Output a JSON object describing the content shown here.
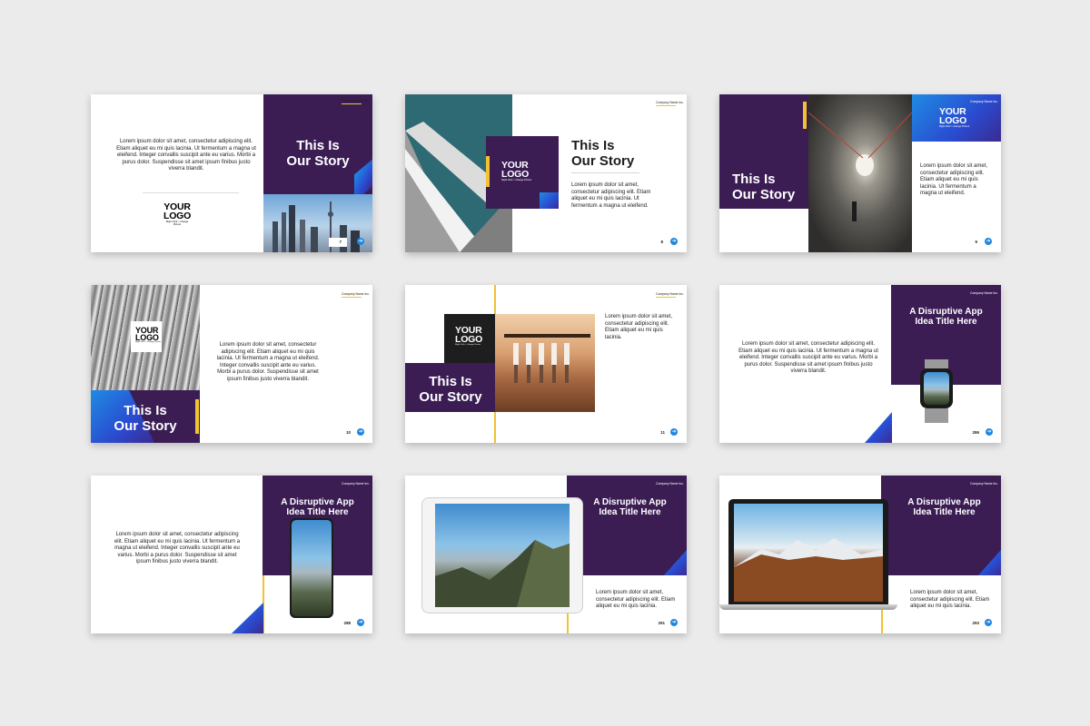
{
  "slides": [
    {
      "body": "Lorem ipsum dolor sit amet, consectetur adipiscing elit. Etiam aliquet eu mi quis lacinia. Ut fermentum a magna ut eleifend. Integer convallis suscipit ante eu varius. Morbi a purus dolor. Suspendisse sit amet ipsum finibus justo viverra blandit.",
      "logo_line1": "YOUR",
      "logo_line2": "LOGO",
      "logo_sub": "Right Click > Change Picture",
      "company": "Company Name Inc.",
      "title_line1": "This Is",
      "title_line2": "Our Story",
      "page": "7"
    },
    {
      "company": "Company Name Inc.",
      "logo_line1": "YOUR",
      "logo_line2": "LOGO",
      "logo_sub": "Right Click > Change Picture",
      "title_line1": "This Is",
      "title_line2": "Our Story",
      "body": "Lorem ipsum dolor sit amet, consectetur adipiscing elit. Etiam aliquet eu mi quis lacinia. Ut fermentum a magna ut eleifend.",
      "page": "8"
    },
    {
      "company": "Company Name Inc.",
      "logo_line1": "YOUR",
      "logo_line2": "LOGO",
      "logo_sub": "Right Click > Change Picture",
      "title_line1": "This Is",
      "title_line2": "Our Story",
      "body": "Lorem ipsum dolor sit amet, consectetur adipiscing elit. Etiam aliquet eu mi quis lacinia. Ut fermentum a magna ut eleifend.",
      "page": "9"
    },
    {
      "logo_line1": "YOUR",
      "logo_line2": "LOGO",
      "logo_sub": "Right Click > Change Picture",
      "title_line1": "This Is",
      "title_line2": "Our Story",
      "company": "Company Name Inc.",
      "body": "Lorem ipsum dolor sit amet, consectetur adipiscing elit. Etiam aliquet eu mi quis lacinia. Ut fermentum a magna ut eleifend. Integer convallis suscipit ante eu varius. Morbi a purus dolor. Suspendisse sit amet ipsum finibus justo viverra blandit.",
      "page": "10"
    },
    {
      "company": "Company Name Inc.",
      "logo_line1": "YOUR",
      "logo_line2": "LOGO",
      "logo_sub": "Right Click > Change Picture",
      "title_line1": "This Is",
      "title_line2": "Our Story",
      "body": "Lorem ipsum dolor sit amet, consectetur adipiscing elit. Etiam aliquet eu mi quis lacinia.",
      "page": "11"
    },
    {
      "body": "Lorem ipsum dolor sit amet, consectetur adipiscing elit. Etiam aliquet eu mi quis lacinia. Ut fermentum a magna ut eleifend. Integer convallis suscipit ante eu varius. Morbi a purus dolor. Suspendisse sit amet ipsum finibus justo viverra blandit.",
      "company": "Company Name Inc.",
      "title_line1": "A Disruptive App",
      "title_line2": "Idea Title Here",
      "page": "286"
    },
    {
      "body": "Lorem ipsum dolor sit amet, consectetur adipiscing elit. Etiam aliquet eu mi quis lacinia. Ut fermentum a magna ut eleifend. Integer convallis suscipit ante eu varius. Morbi a purus dolor. Suspendisse sit amet ipsum finibus justo viverra blandit.",
      "company": "Company Name Inc.",
      "title_line1": "A Disruptive App",
      "title_line2": "Idea Title Here",
      "page": "288"
    },
    {
      "company": "Company Name Inc.",
      "title_line1": "A Disruptive App",
      "title_line2": "Idea Title Here",
      "body": "Lorem ipsum dolor sit amet, consectetur adipiscing elit. Etiam aliquet eu mi quis lacinia.",
      "page": "291"
    },
    {
      "company": "Company Name Inc.",
      "title_line1": "A Disruptive App",
      "title_line2": "Idea Title Here",
      "body": "Lorem ipsum dolor sit amet, consectetur adipiscing elit. Etiam aliquet eu mi quis lacinia.",
      "page": "293"
    }
  ],
  "colors": {
    "purple": "#3b1d54",
    "blue": "#1f86e0",
    "yellow": "#f2c230",
    "background": "#ebebeb"
  },
  "icons": {
    "next": "arrow-right-icon"
  },
  "arrow_glyph": "➔"
}
